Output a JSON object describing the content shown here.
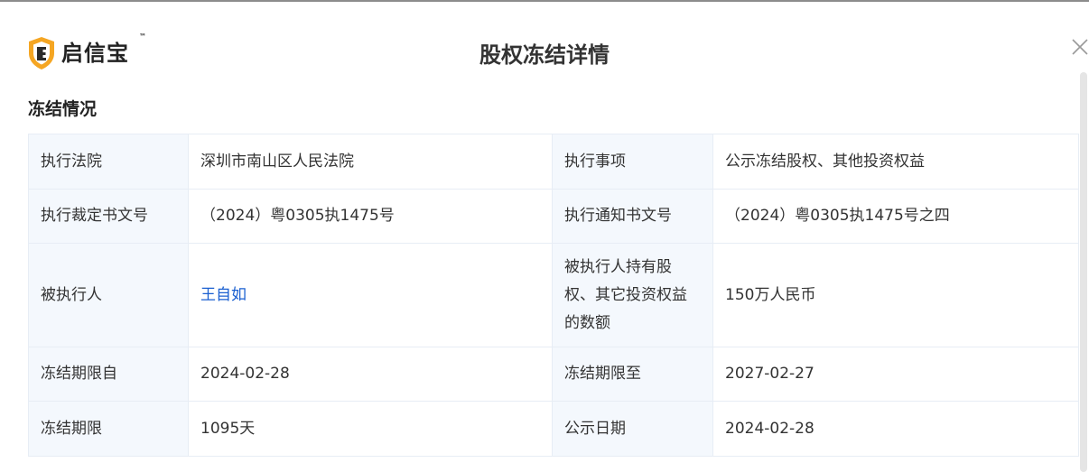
{
  "brand": {
    "name": "启信宝",
    "trademark": "™"
  },
  "dialog": {
    "title": "股权冻结详情"
  },
  "section": {
    "title": "冻结情况"
  },
  "rows": [
    {
      "label1": "执行法院",
      "value1": "深圳市南山区人民法院",
      "label2": "执行事项",
      "value2": "公示冻结股权、其他投资权益"
    },
    {
      "label1": "执行裁定书文号",
      "value1": "（2024）粤0305执1475号",
      "label2": "执行通知书文号",
      "value2": "（2024）粤0305执1475号之四"
    },
    {
      "label1": "被执行人",
      "value1": "王自如",
      "label2": "被执行人持有股权、其它投资权益的数额",
      "value2": "150万人民币"
    },
    {
      "label1": "冻结期限自",
      "value1": "2024-02-28",
      "label2": "冻结期限至",
      "value2": "2027-02-27"
    },
    {
      "label1": "冻结期限",
      "value1": "1095天",
      "label2": "公示日期",
      "value2": "2024-02-28"
    }
  ],
  "colors": {
    "brand_orange": "#f5a623",
    "link": "#1a5fd0",
    "label_bg": "#f4f8fd",
    "border": "#e7edf5"
  },
  "icons": {
    "logo": "shield-logo-icon",
    "close": "close-icon"
  }
}
